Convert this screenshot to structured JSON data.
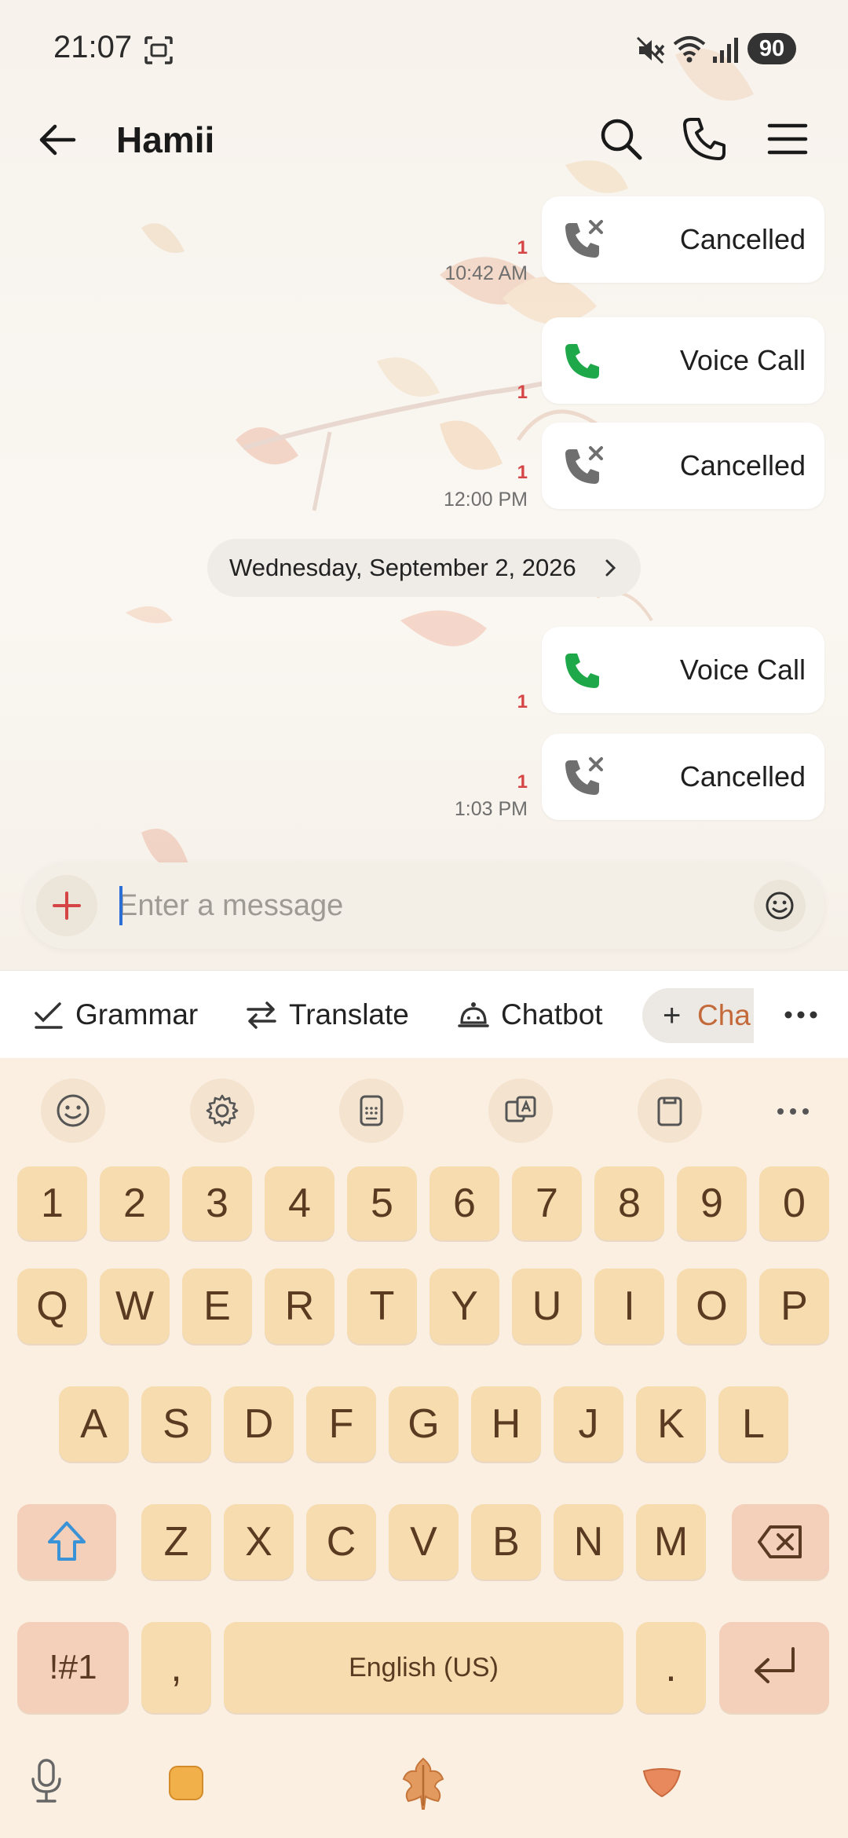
{
  "status_bar": {
    "time": "21:07",
    "battery": "90"
  },
  "header": {
    "contact_name": "Hamii"
  },
  "messages": [
    {
      "type": "cancelled",
      "label": "Cancelled",
      "unread": "1",
      "time": "10:42 AM"
    },
    {
      "type": "voice",
      "label": "Voice Call",
      "unread": "1",
      "time": ""
    },
    {
      "type": "cancelled",
      "label": "Cancelled",
      "unread": "1",
      "time": "12:00 PM"
    },
    {
      "type": "voice",
      "label": "Voice Call",
      "unread": "1",
      "time": ""
    },
    {
      "type": "cancelled",
      "label": "Cancelled",
      "unread": "1",
      "time": "1:03 PM"
    }
  ],
  "date_divider": "Wednesday, September 2, 2026",
  "composer": {
    "placeholder": "Enter a message"
  },
  "suggestions": {
    "grammar": "Grammar",
    "translate": "Translate",
    "chatbot": "Chatbot",
    "chat": "Cha"
  },
  "keyboard": {
    "numbers": [
      "1",
      "2",
      "3",
      "4",
      "5",
      "6",
      "7",
      "8",
      "9",
      "0"
    ],
    "row1": [
      "Q",
      "W",
      "E",
      "R",
      "T",
      "Y",
      "U",
      "I",
      "O",
      "P"
    ],
    "row2": [
      "A",
      "S",
      "D",
      "F",
      "G",
      "H",
      "J",
      "K",
      "L"
    ],
    "row3": [
      "Z",
      "X",
      "C",
      "V",
      "B",
      "N",
      "M"
    ],
    "symbols_key": "!#1",
    "comma_key": ",",
    "space_label": "English (US)",
    "period_key": "."
  },
  "colors": {
    "accent_red": "#d64545",
    "voice_green": "#1fa84a",
    "key_face": "#f6dcae",
    "key_text": "#5b3a22",
    "keyboard_bg": "#fbefe2"
  }
}
